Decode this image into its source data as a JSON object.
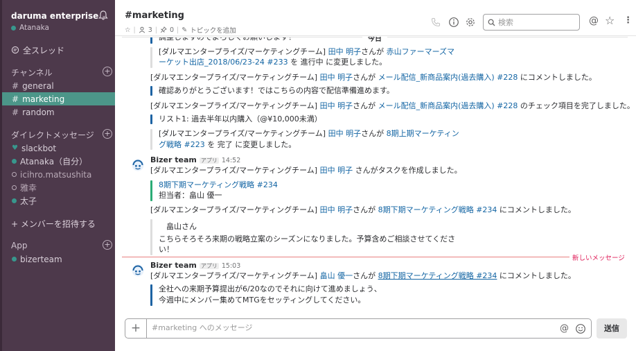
{
  "sidebar": {
    "team_name": "daruma enterprise",
    "user_status": "Atanaka",
    "all_threads": "全スレッド",
    "channels_header": "チャンネル",
    "channels": [
      {
        "name": "general"
      },
      {
        "name": "marketing"
      },
      {
        "name": "random"
      }
    ],
    "dm_header": "ダイレクトメッセージ",
    "dms": [
      {
        "name": "slackbot",
        "status": "heart"
      },
      {
        "name": "Atanaka（自分）",
        "status": "online"
      },
      {
        "name": "icihro.matsushita",
        "status": "away"
      },
      {
        "name": "雅幸",
        "status": "away"
      },
      {
        "name": "太子",
        "status": "online"
      }
    ],
    "invite": "+ メンバーを招待する",
    "app_header": "App",
    "apps": [
      {
        "name": "bizerteam",
        "status": "online"
      }
    ]
  },
  "header": {
    "channel": "#marketing",
    "members": "3",
    "pins": "0",
    "topic": "トピックを追加",
    "search_placeholder": "検索"
  },
  "messages": {
    "cut_top": "調整しますのでよろしくお願いします！",
    "day_divider": "今日",
    "new_divider": "新しいメッセージ",
    "block1": {
      "l1_pre": "[ダルマエンタープライズ/マーケティングチーム] ",
      "l1_user": "田中 明子",
      "l1_mid": "さんが ",
      "l1_link": "赤山ファーマーズマ",
      "l2_link": "ーケット出店_2018/06/23-24 #233",
      "l2_post": " を 進行中 に変更しました。"
    },
    "block2": {
      "pre": "[ダルマエンタープライズ/マーケティングチーム] ",
      "user": "田中 明子",
      "mid": "さんが ",
      "link": "メール配信_新商品案内(過去購入) #228",
      "post": " にコメントしました。",
      "quote": "確認ありがとうございます！ではこちらの内容で配信準備進めます。"
    },
    "block3": {
      "pre": "[ダルマエンタープライズ/マーケティングチーム] ",
      "user": "田中 明子",
      "mid": "さんが ",
      "link": "メール配信_新商品案内(過去購入) #228",
      "post": " のチェック項目を完了しました。",
      "quote": "リスト1: 過去半年以内購入（@¥10,000未満）"
    },
    "block4": {
      "l1_pre": "[ダルマエンタープライズ/マーケティングチーム] ",
      "l1_user": "田中 明子",
      "l1_mid": "さんが ",
      "l1_link": "8期上期マーケティン",
      "l2_link": "グ戦略 #223",
      "l2_post": " を 完了 に変更しました。"
    },
    "msg1": {
      "sender": "Bizer team",
      "badge": "アプリ",
      "time": "14:52",
      "line1_pre": "[ダルマエンタープライズ/マーケティングチーム] ",
      "line1_user": "田中 明子",
      "line1_post": " さんがタスクを作成しました。",
      "task_link": "8期下期マーケティング戦略 #234",
      "assignee": "担当者：畠山 優一",
      "line2_pre": "[ダルマエンタープライズ/マーケティングチーム] ",
      "line2_user": "田中 明子",
      "line2_mid": "さんが ",
      "line2_link": "8期下期マーケティング戦略 #234",
      "line2_post": " にコメントしました。",
      "quote_name": "畠山さん",
      "quote_l1": "こちらそろそろ来期の戦略立案のシーズンになりました。予算含めご相談させてくださ",
      "quote_l2": "い！"
    },
    "msg2": {
      "sender": "Bizer team",
      "badge": "アプリ",
      "time": "15:03",
      "line_pre": "[ダルマエンタープライズ/マーケティングチーム] ",
      "line_user": "畠山 優一",
      "line_mid": "さんが ",
      "line_link": "8期下期マーケティング戦略 #234",
      "line_post": " にコメントしました。",
      "quote_l1": "全社への来期予算提出が6/20なのでそれに向けて進めましょう、",
      "quote_l2": "今週中にメンバー集めてMTGをセッティングしてください。"
    }
  },
  "composer": {
    "placeholder": "#marketing へのメッセージ",
    "send_label": "送信"
  },
  "colors": {
    "sidebar_bg": "#4d394b",
    "active_channel": "#4c9689",
    "link": "#1264a3",
    "new_message": "#e01e5a"
  }
}
